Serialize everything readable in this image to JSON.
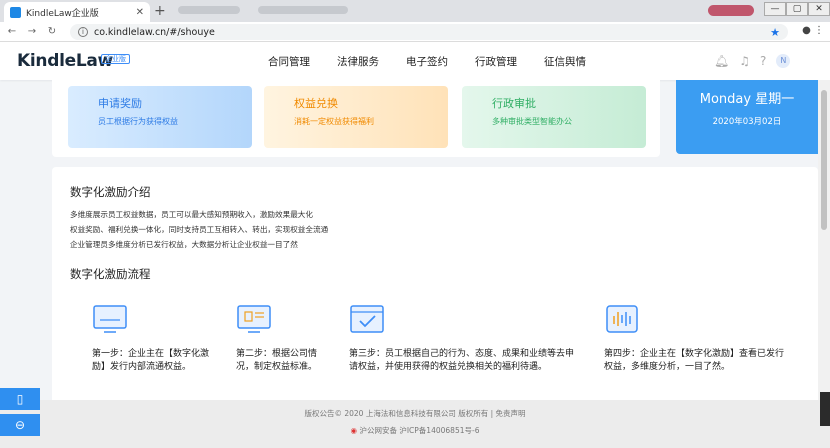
{
  "browser": {
    "tab_title": "KindleLaw企业版",
    "tab_close": "✕",
    "new_tab": "+",
    "url": "co.kindlelaw.cn/#/shouye",
    "back": "←",
    "forward": "→",
    "reload": "↻",
    "window_controls": [
      "—",
      "▢",
      "✕"
    ]
  },
  "header": {
    "logo": "KindleLaw",
    "edition_badge": "企业版",
    "nav": [
      "合同管理",
      "法律服务",
      "电子签约",
      "行政管理",
      "征信舆情"
    ],
    "avatar_text": "N"
  },
  "features": [
    {
      "title": "申请奖励",
      "subtitle": "员工根据行为获得权益"
    },
    {
      "title": "权益兑换",
      "subtitle": "消耗一定权益获得福利"
    },
    {
      "title": "行政审批",
      "subtitle": "多种审批类型智能办公"
    }
  ],
  "date_card": {
    "weekday": "Monday   星期一",
    "date": "2020年03月02日"
  },
  "intro": {
    "title": "数字化激励介绍",
    "lines": [
      "多维度展示员工权益数据，员工可以最大感知预期收入，激励效果最大化",
      "权益奖励、福利兑换一体化，同时支持员工互相转入、转出，实现权益全流通",
      "企业管理员多维度分析已发行权益，大数据分析让企业权益一目了然"
    ],
    "process_title": "数字化激励流程"
  },
  "steps": [
    {
      "text": "第一步：企业主在【数字化激励】发行内部流通权益。"
    },
    {
      "text": "第二步：根据公司情况，制定权益标准。"
    },
    {
      "text": "第三步：员工根据自己的行为、态度、成果和业绩等去申请权益，并使用获得的权益兑换相关的福利待遇。"
    },
    {
      "text": "第四步：企业主在【数字化激励】查看已发行权益，多维度分析，一目了然。"
    }
  ],
  "footer": {
    "copyright": "版权公告© 2020 上海法和信息科技有限公司 版权所有 | 免责声明",
    "icp": "沪公网安备 沪ICP备14006851号-6"
  },
  "colors": {
    "accent": "#2f8ff0",
    "date_card": "#3b9df2"
  }
}
